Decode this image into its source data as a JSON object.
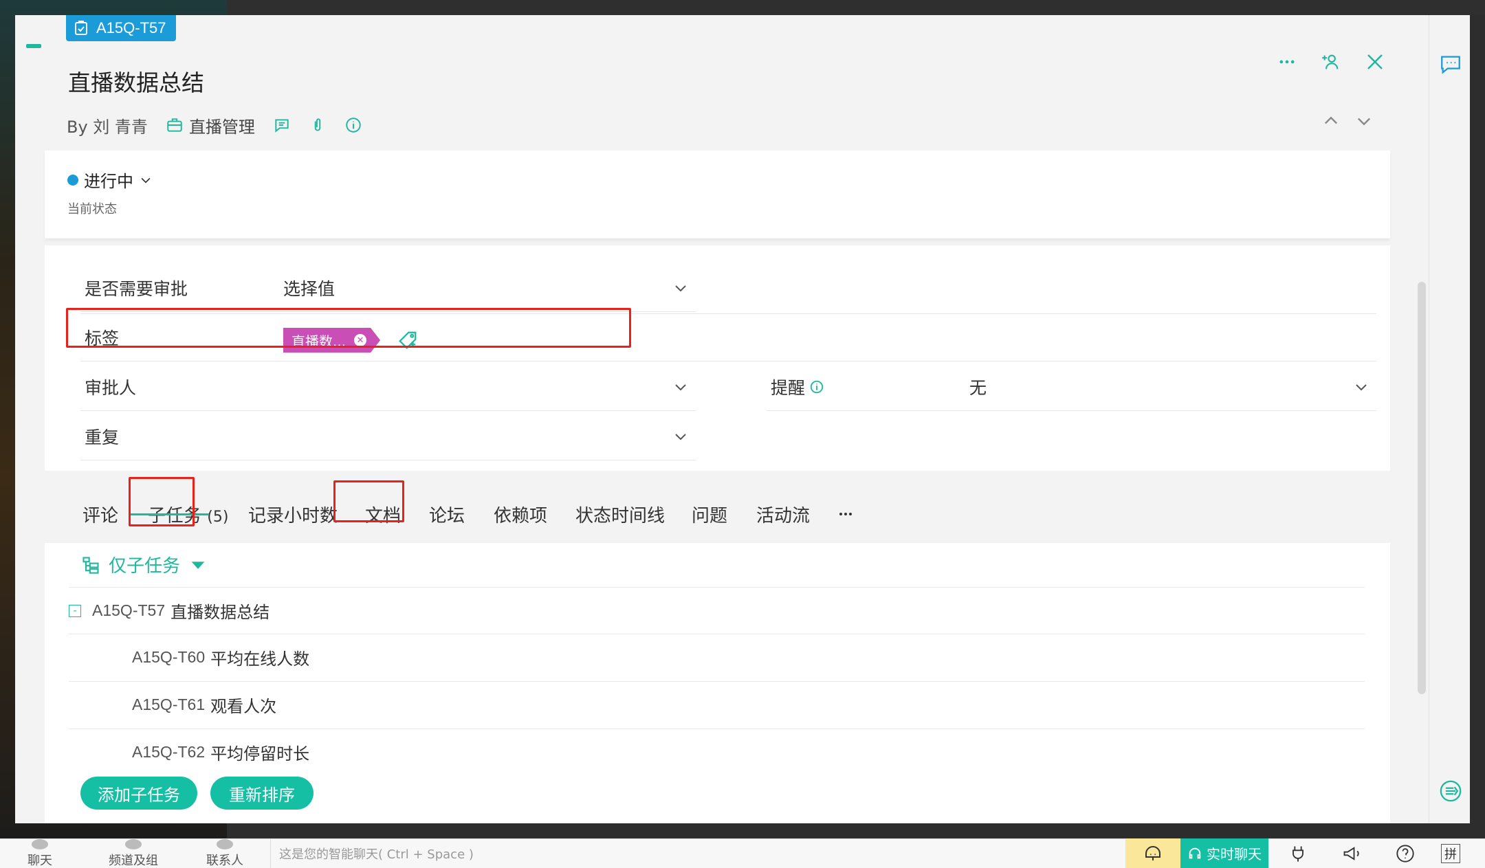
{
  "task": {
    "id": "A15Q-T57",
    "title": "直播数据总结",
    "author": "By 刘 青青",
    "project": "直播管理"
  },
  "status": {
    "label": "进行中",
    "sublabel": "当前状态",
    "color": "#1b9bd8"
  },
  "fields": {
    "approval": {
      "label": "是否需要审批",
      "value": "选择值"
    },
    "tags": {
      "label": "标签",
      "chip": "直播数..."
    },
    "approver": {
      "label": "审批人",
      "value": ""
    },
    "reminder": {
      "label": "提醒",
      "value": "无"
    },
    "repeat": {
      "label": "重复",
      "value": ""
    }
  },
  "tabs": [
    {
      "label": "评论"
    },
    {
      "label": "子任务",
      "count": "(5)"
    },
    {
      "label": "记录小时数"
    },
    {
      "label": "文档"
    },
    {
      "label": "论坛"
    },
    {
      "label": "依赖项"
    },
    {
      "label": "状态时间线"
    },
    {
      "label": "问题"
    },
    {
      "label": "活动流"
    }
  ],
  "subtasks": {
    "filter": "仅子任务",
    "parent": {
      "code": "A15Q-T57",
      "name": "直播数据总结"
    },
    "items": [
      {
        "code": "A15Q-T60",
        "name": "平均在线人数"
      },
      {
        "code": "A15Q-T61",
        "name": "观看人次"
      },
      {
        "code": "A15Q-T62",
        "name": "平均停留时长"
      }
    ],
    "add_button": "添加子任务",
    "reorder_button": "重新排序"
  },
  "bottom_bar": {
    "chat": "聊天",
    "channels": "频道及组",
    "contacts": "联系人",
    "input_placeholder": "这是您的智能聊天( Ctrl + Space )",
    "live_chat": "实时聊天",
    "ime": "拼"
  },
  "colors": {
    "accent": "#1fb89f",
    "badge": "#1b9bd8",
    "tag": "#c94fb6",
    "highlight": "#e8221b"
  }
}
